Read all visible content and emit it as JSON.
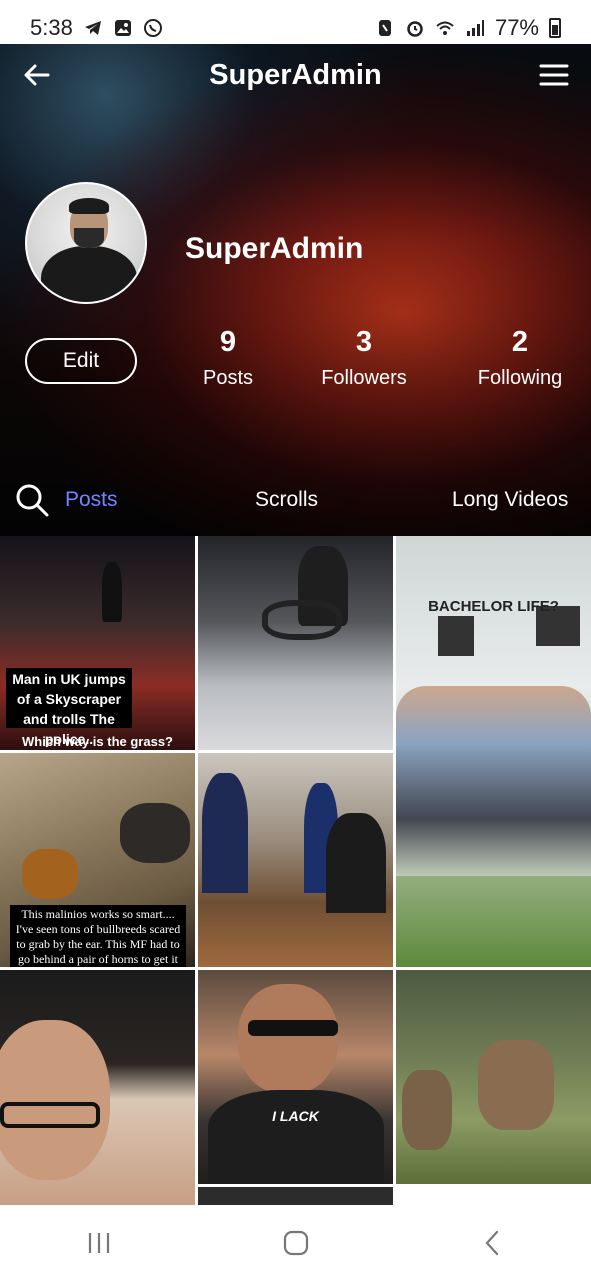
{
  "status_bar": {
    "time": "5:38",
    "battery": "77%",
    "left_icons": [
      "telegram-icon",
      "gallery-icon",
      "whatsapp-icon"
    ],
    "right_icons": [
      "nfc-icon",
      "alarm-icon",
      "wifi-icon",
      "signal-icon",
      "battery-icon"
    ]
  },
  "header": {
    "title": "SuperAdmin",
    "back_icon": "arrow-left-icon",
    "menu_icon": "hamburger-menu-icon"
  },
  "profile": {
    "name": "SuperAdmin",
    "edit_label": "Edit",
    "stats": {
      "posts_count": "9",
      "posts_label": "Posts",
      "followers_count": "3",
      "followers_label": "Followers",
      "following_count": "2",
      "following_label": "Following"
    }
  },
  "tabs": {
    "search_icon": "search-icon",
    "items": [
      {
        "label": "Posts",
        "active": true
      },
      {
        "label": "Scrolls",
        "active": false
      },
      {
        "label": "Long Videos",
        "active": false
      }
    ]
  },
  "grid": {
    "tiles": [
      {
        "caption": "Man in UK jumps of a Skyscraper and trolls The police..",
        "subcaption": "Which way is the grass?"
      },
      {
        "caption": ""
      },
      {
        "caption": "BACHELOR LIFE?"
      },
      {
        "caption": "This malinios works so smart.... I've seen tons of bullbreeds scared to grab by the ear. This MF had to go behind a pair of horns to get it and did it"
      },
      {
        "caption": ""
      },
      {
        "caption": ""
      },
      {
        "caption": "I LACK"
      },
      {
        "caption": ""
      },
      {
        "caption": ""
      }
    ]
  },
  "colors": {
    "accent_tab": "#6f86ff",
    "background": "#000000",
    "text": "#ffffff"
  }
}
